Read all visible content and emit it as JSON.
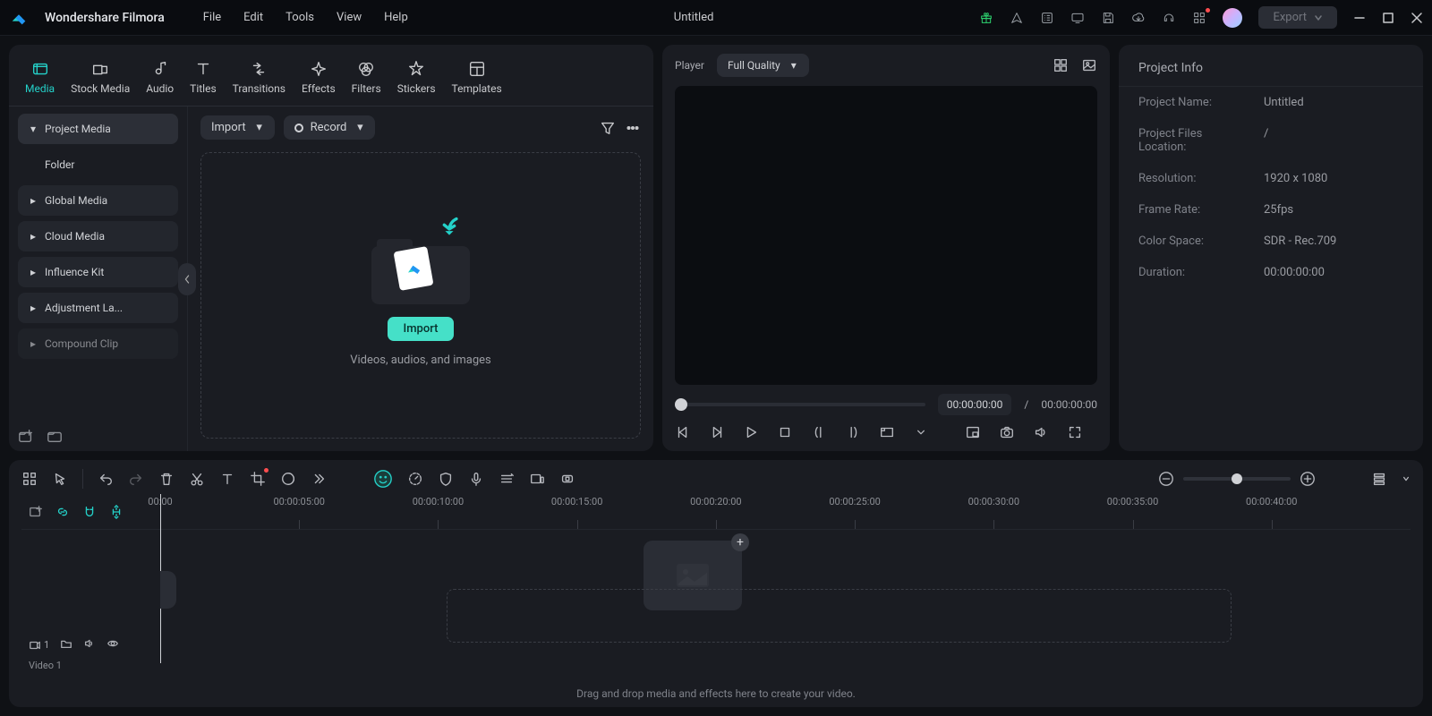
{
  "brand": "Wondershare Filmora",
  "menu": [
    "File",
    "Edit",
    "Tools",
    "View",
    "Help"
  ],
  "doc_title": "Untitled",
  "export_label": "Export",
  "media_tabs": [
    {
      "key": "media",
      "label": "Media"
    },
    {
      "key": "stock",
      "label": "Stock Media"
    },
    {
      "key": "audio",
      "label": "Audio"
    },
    {
      "key": "titles",
      "label": "Titles"
    },
    {
      "key": "transitions",
      "label": "Transitions"
    },
    {
      "key": "effects",
      "label": "Effects"
    },
    {
      "key": "filters",
      "label": "Filters"
    },
    {
      "key": "stickers",
      "label": "Stickers"
    },
    {
      "key": "templates",
      "label": "Templates"
    }
  ],
  "sidebar": {
    "project_media": "Project Media",
    "folder": "Folder",
    "items": [
      "Global Media",
      "Cloud Media",
      "Influence Kit",
      "Adjustment La...",
      "Compound Clip"
    ]
  },
  "media_toolbar": {
    "import": "Import",
    "record": "Record"
  },
  "dropzone": {
    "import": "Import",
    "hint": "Videos, audios, and images"
  },
  "player": {
    "label": "Player",
    "quality": "Full Quality",
    "tc_current": "00:00:00:00",
    "tc_sep": "/",
    "tc_total": "00:00:00:00"
  },
  "info": {
    "title": "Project Info",
    "rows": [
      {
        "lbl": "Project Name:",
        "val": "Untitled"
      },
      {
        "lbl": "Project Files Location:",
        "val": "/"
      },
      {
        "lbl": "Resolution:",
        "val": "1920 x 1080"
      },
      {
        "lbl": "Frame Rate:",
        "val": "25fps"
      },
      {
        "lbl": "Color Space:",
        "val": "SDR - Rec.709"
      },
      {
        "lbl": "Duration:",
        "val": "00:00:00:00"
      }
    ]
  },
  "ruler": [
    "00:00",
    "00:00:05:00",
    "00:00:10:00",
    "00:00:15:00",
    "00:00:20:00",
    "00:00:25:00",
    "00:00:30:00",
    "00:00:35:00",
    "00:00:40:00"
  ],
  "track_label": "Video 1",
  "timeline_hint": "Drag and drop media and effects here to create your video.",
  "track_toggles": {
    "cam": "1"
  }
}
